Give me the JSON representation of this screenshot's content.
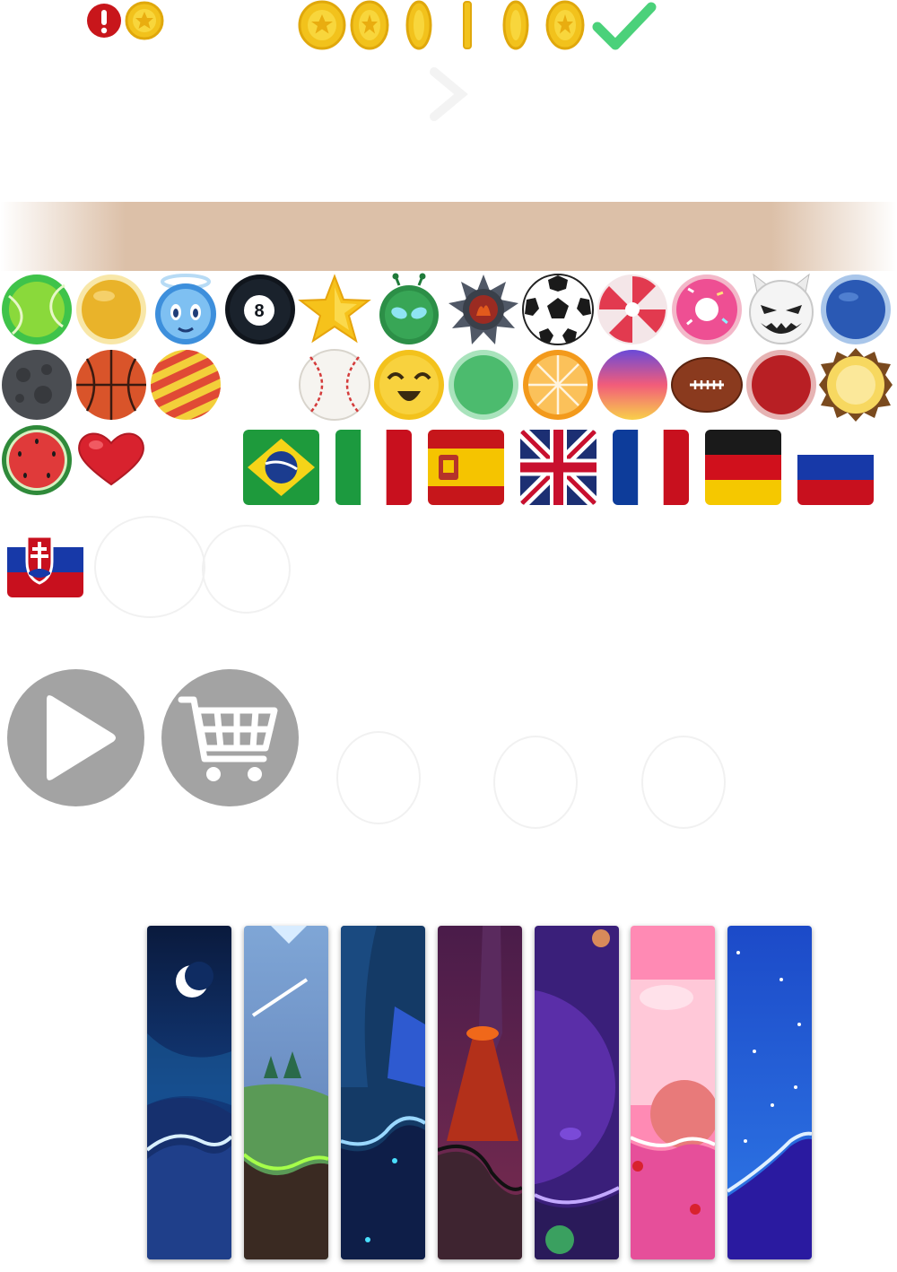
{
  "colors": {
    "coin": "#f2c21c",
    "alert": "#c8161b",
    "check": "#4bd17a",
    "banner": "#dcc0a8",
    "button_grey": "#a3a3a3"
  },
  "icons": {
    "status": [
      "alert-icon",
      "coin-icon"
    ],
    "coin_spin_frames": [
      "coin-frame-1",
      "coin-frame-2",
      "coin-frame-3",
      "coin-frame-4",
      "coin-frame-5",
      "coin-frame-6"
    ],
    "confirm": "checkmark-icon",
    "buttons": [
      "play-icon",
      "cart-icon"
    ]
  },
  "balls": {
    "row1": [
      "tennis-ball",
      "gold-ball",
      "angel-ball",
      "eight-ball",
      "star-ball",
      "alien-ball",
      "spiked-mine-ball",
      "soccer-ball",
      "candy-swirl-ball",
      "donut-ball",
      "devil-ball",
      "blue-ball"
    ],
    "row2": [
      "moon-ball",
      "basketball",
      "striped-ball",
      "baseball",
      "smiley-ball",
      "green-ball",
      "orange-slice-ball",
      "gradient-ball",
      "football",
      "red-ball",
      "pineapple-ball"
    ],
    "row3": [
      "watermelon-ball",
      "heart-ball"
    ]
  },
  "flags": [
    "brazil-flag",
    "italy-flag",
    "spain-flag",
    "uk-flag",
    "france-flag",
    "germany-flag",
    "russia-flag",
    "slovakia-flag"
  ],
  "themes": [
    "night-theme",
    "forest-theme",
    "cave-theme",
    "volcano-theme",
    "space-purple-theme",
    "candy-theme",
    "starry-theme"
  ]
}
